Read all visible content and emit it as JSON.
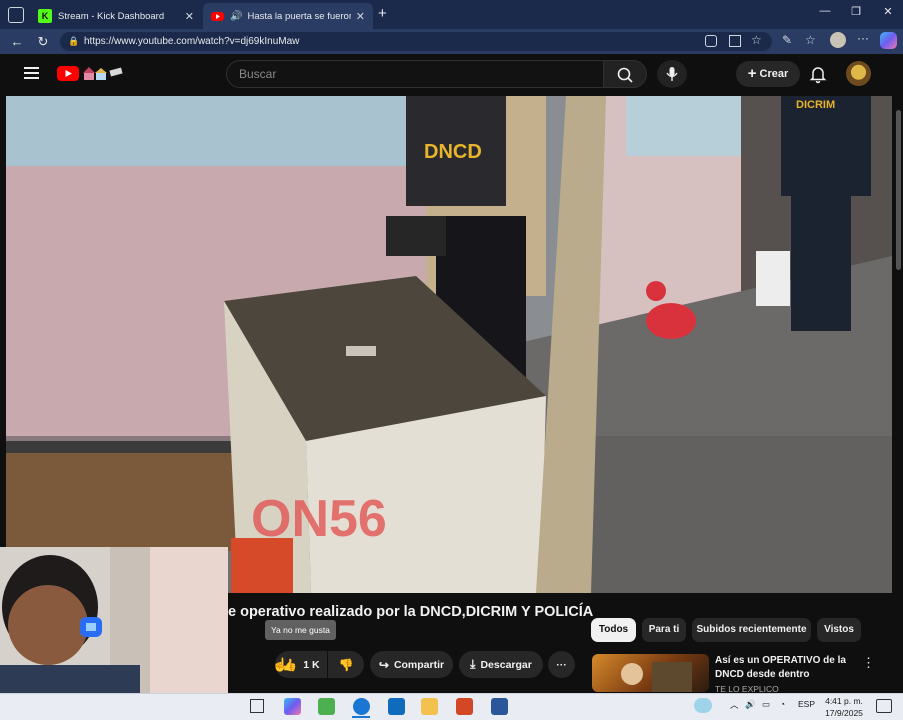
{
  "browser": {
    "tabs": [
      {
        "label": "Stream - Kick Dashboard",
        "favicon": "K",
        "active": false
      },
      {
        "label": "Hasta la puerta se fueron en",
        "active": true
      }
    ],
    "url": "https://www.youtube.com/watch?v=dj69kInuMaw"
  },
  "youtube": {
    "search_placeholder": "Buscar",
    "create_label": "Crear",
    "video": {
      "watermark": "ON56",
      "vest_text": "DNCD",
      "vest_text_2": "DICRIM"
    },
    "video_title": "e operativo realizado por la DNCD,DICRIM Y POLICÍA",
    "tooltip": "Ya no me gusta",
    "actions": {
      "like_count": "1 K",
      "share_label": "Compartir",
      "download_label": "Descargar"
    },
    "chips": [
      "Todos",
      "Para ti",
      "Subidos recientemente",
      "Vistos"
    ],
    "recommendation": {
      "title": "Así es un OPERATIVO de la DNCD desde dentro",
      "channel": "TE LO EXPLICO"
    }
  },
  "taskbar": {
    "language": "ESP",
    "time": "4:41 p. m.",
    "date": "17/9/2025"
  },
  "colors": {
    "youtube_red": "#ff0000",
    "chip_active_bg": "#f1f1f1",
    "chip_bg": "#272727",
    "tab_strip": "#1b2a4a"
  }
}
